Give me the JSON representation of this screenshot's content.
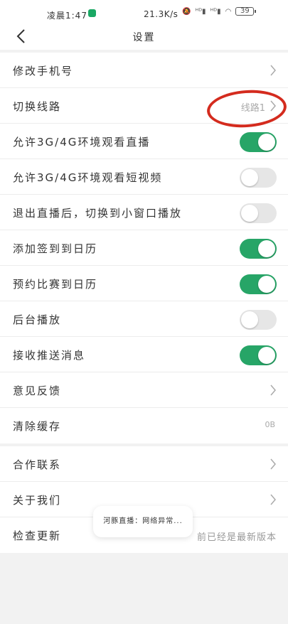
{
  "status_bar": {
    "time": "凌晨1:47",
    "speed": "21.3K/s",
    "battery": "39"
  },
  "header": {
    "title": "设置"
  },
  "settings": {
    "change_phone": {
      "label": "修改手机号"
    },
    "switch_line": {
      "label": "切换线路",
      "value": "线路1"
    },
    "allow_live_mobile": {
      "label": "允许3G/4G环境观看直播",
      "on": true
    },
    "allow_short_video_mobile": {
      "label": "允许3G/4G环境观看短视频",
      "on": false
    },
    "mini_window": {
      "label": "退出直播后，切换到小窗口播放",
      "on": false
    },
    "add_checkin_calendar": {
      "label": "添加签到到日历",
      "on": true
    },
    "reserve_match_calendar": {
      "label": "预约比赛到日历",
      "on": true
    },
    "background_play": {
      "label": "后台播放",
      "on": false
    },
    "receive_push": {
      "label": "接收推送消息",
      "on": true
    },
    "feedback": {
      "label": "意见反馈"
    },
    "clear_cache": {
      "label": "清除缓存",
      "value": "0B"
    }
  },
  "about": {
    "cooperation": {
      "label": "合作联系"
    },
    "about_us": {
      "label": "关于我们"
    },
    "check_update": {
      "label": "检查更新",
      "value": "前已经是最新版本"
    }
  },
  "toast": {
    "text": "河豚直播：网络异常..."
  },
  "colors": {
    "toggle_on": "#27a567",
    "toggle_off": "#e6e6e6",
    "annotation": "#d42b1e"
  }
}
